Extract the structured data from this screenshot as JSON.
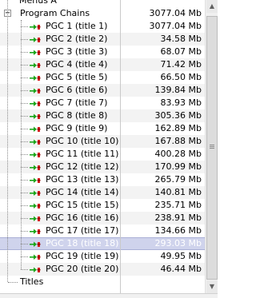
{
  "tree": {
    "top_item": {
      "name": "Menus A",
      "size": ""
    },
    "program_chains": {
      "name": "Program Chains",
      "size": "3077.04 Mb",
      "expander": "−"
    },
    "items": [
      {
        "name": "PGC 1  (title 1)",
        "size": "3077.04 Mb"
      },
      {
        "name": "PGC 2  (title 2)",
        "size": "34.58 Mb"
      },
      {
        "name": "PGC 3  (title 3)",
        "size": "68.07 Mb"
      },
      {
        "name": "PGC 4  (title 4)",
        "size": "71.42 Mb"
      },
      {
        "name": "PGC 5  (title 5)",
        "size": "66.50 Mb"
      },
      {
        "name": "PGC 6  (title 6)",
        "size": "139.84 Mb"
      },
      {
        "name": "PGC 7  (title 7)",
        "size": "83.93 Mb"
      },
      {
        "name": "PGC 8  (title 8)",
        "size": "305.36 Mb"
      },
      {
        "name": "PGC 9  (title 9)",
        "size": "162.89 Mb"
      },
      {
        "name": "PGC 10  (title 10)",
        "size": "167.88 Mb"
      },
      {
        "name": "PGC 11  (title 11)",
        "size": "400.28 Mb"
      },
      {
        "name": "PGC 12  (title 12)",
        "size": "170.99 Mb"
      },
      {
        "name": "PGC 13  (title 13)",
        "size": "265.79 Mb"
      },
      {
        "name": "PGC 14  (title 14)",
        "size": "140.81 Mb"
      },
      {
        "name": "PGC 15  (title 15)",
        "size": "235.71 Mb"
      },
      {
        "name": "PGC 16  (title 16)",
        "size": "238.91 Mb"
      },
      {
        "name": "PGC 17  (title 17)",
        "size": "134.66 Mb"
      },
      {
        "name": "PGC 18  (title 18)",
        "size": "293.03 Mb",
        "selected": true
      },
      {
        "name": "PGC 19  (title 19)",
        "size": "49.95 Mb"
      },
      {
        "name": "PGC 20  (title 20)",
        "size": "46.44 Mb"
      }
    ],
    "titles": {
      "name": "Titles"
    }
  },
  "icons": {
    "pgc": "pgc-arrow-icon",
    "expander": "collapse-icon",
    "scroll_up": "scroll-up-arrow-icon",
    "scroll_down": "scroll-down-arrow-icon"
  },
  "colors": {
    "selection": "#cfd3ec",
    "stripe": "#f3f3f3",
    "icon_green": "#1aa61a",
    "icon_red": "#d41a1a"
  }
}
